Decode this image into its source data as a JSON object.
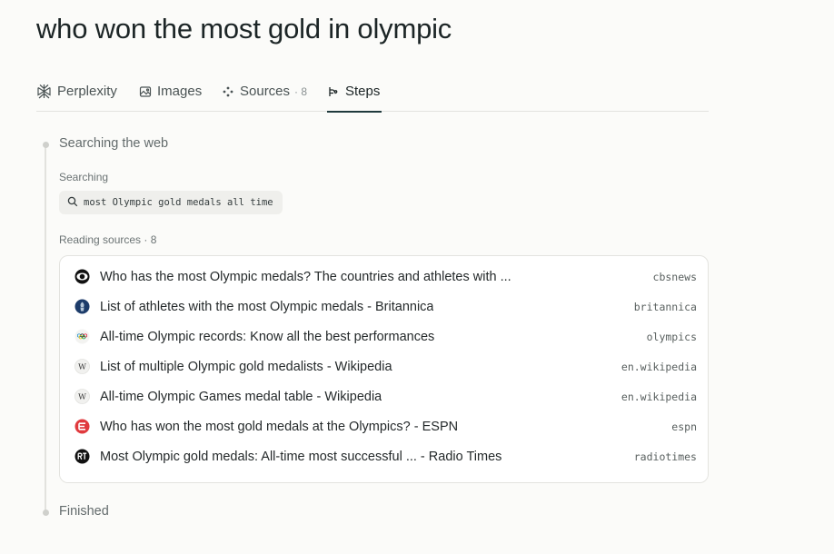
{
  "query": "who won the most gold in olympic",
  "tabs": [
    {
      "label": "Perplexity",
      "icon": "perplexity-logo-icon",
      "active": false
    },
    {
      "label": "Images",
      "icon": "image-icon",
      "active": false
    },
    {
      "label": "Sources",
      "count": "· 8",
      "icon": "sources-icon",
      "active": false
    },
    {
      "label": "Steps",
      "icon": "steps-icon",
      "active": true
    }
  ],
  "steps": {
    "searching_web": "Searching the web",
    "searching_label": "Searching",
    "search_query": "most Olympic gold medals all time",
    "reading_label": "Reading sources · 8",
    "finished": "Finished"
  },
  "sources": [
    {
      "title": "Who has the most Olympic medals? The countries and athletes with ...",
      "domain": "cbsnews",
      "icon": "cbs-eye-icon"
    },
    {
      "title": "List of athletes with the most Olympic medals - Britannica",
      "domain": "britannica",
      "icon": "britannica-thistle-icon"
    },
    {
      "title": "All-time Olympic records: Know all the best performances",
      "domain": "olympics",
      "icon": "olympic-rings-icon"
    },
    {
      "title": "List of multiple Olympic gold medalists - Wikipedia",
      "domain": "en.wikipedia",
      "icon": "wikipedia-icon"
    },
    {
      "title": "All-time Olympic Games medal table - Wikipedia",
      "domain": "en.wikipedia",
      "icon": "wikipedia-icon"
    },
    {
      "title": "Who has won the most gold medals at the Olympics? - ESPN",
      "domain": "espn",
      "icon": "espn-icon"
    },
    {
      "title": "Most Olympic gold medals: All-time most successful ... - Radio Times",
      "domain": "radiotimes",
      "icon": "radiotimes-icon"
    }
  ],
  "colors": {
    "background": "#fbfbf9",
    "active_tab_underline": "#1f3a3d",
    "espn_red": "#e03a3e"
  }
}
